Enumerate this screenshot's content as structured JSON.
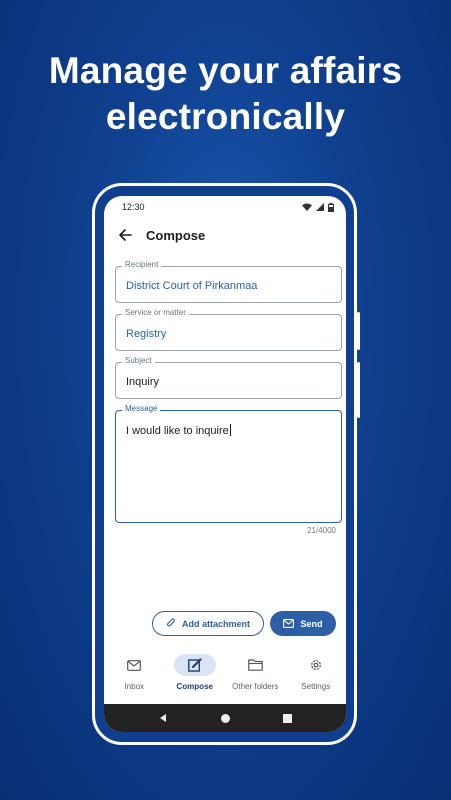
{
  "headline": {
    "line1": "Manage your affairs",
    "line2": "electronically"
  },
  "status_bar": {
    "time": "12:30",
    "icons": [
      "wifi-icon",
      "signal-icon",
      "battery-icon"
    ]
  },
  "app_bar": {
    "title": "Compose",
    "back_icon": "arrow-left-icon"
  },
  "form": {
    "recipient": {
      "label": "Recipient",
      "value": "District Court of Pirkanmaa"
    },
    "service": {
      "label": "Service or matter",
      "value": "Registry"
    },
    "subject": {
      "label": "Subject",
      "value": "Inquiry"
    },
    "message": {
      "label": "Message",
      "value": "I would like to inquire"
    },
    "counter": "21/4000"
  },
  "actions": {
    "attach_label": "Add attachment",
    "send_label": "Send"
  },
  "bottom_nav": [
    {
      "label": "Inbox",
      "icon": "mail-icon",
      "active": false
    },
    {
      "label": "Compose",
      "icon": "edit-icon",
      "active": true
    },
    {
      "label": "Other folders",
      "icon": "folder-icon",
      "active": false
    },
    {
      "label": "Settings",
      "icon": "gear-icon",
      "active": false
    }
  ],
  "colors": {
    "accent": "#2c5fa8",
    "background": "#0f3f8e"
  }
}
